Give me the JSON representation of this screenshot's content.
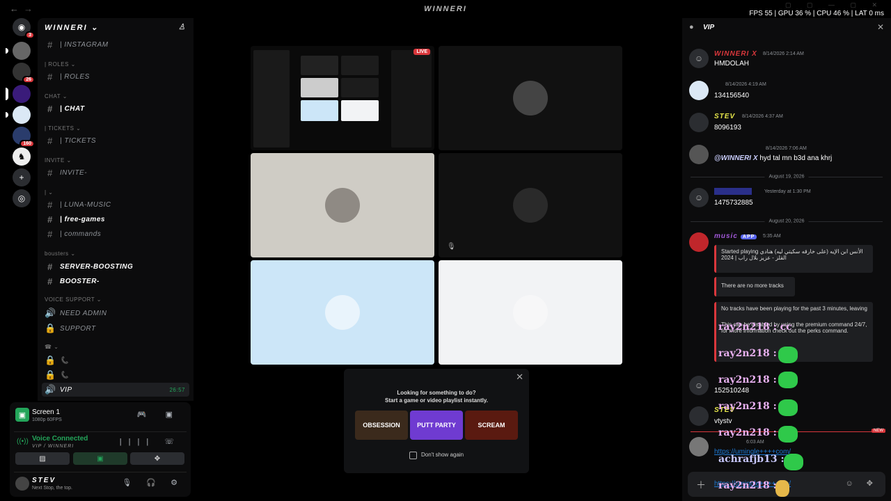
{
  "topbar": {
    "title": "WINNERI",
    "stats": "FPS  55  |  GPU 36 %  |  CPU 46 %  |  LAT 0 ms"
  },
  "rail": {
    "badges": [
      "3",
      "26",
      "160"
    ]
  },
  "server": {
    "name": "WINNERI"
  },
  "channels": [
    {
      "label": "| INSTAGRAM",
      "kind": "text"
    },
    {
      "label": "| ROLES",
      "kind": "category"
    },
    {
      "label": "| ROLES",
      "kind": "text"
    },
    {
      "label": "CHAT",
      "kind": "category"
    },
    {
      "label": "| CHAT",
      "kind": "text",
      "white": true
    },
    {
      "label": "| TICKETS",
      "kind": "category"
    },
    {
      "label": "| TICKETS",
      "kind": "text"
    },
    {
      "label": "INVITE",
      "kind": "category"
    },
    {
      "label": "INVITE-",
      "kind": "text"
    },
    {
      "label": "|",
      "kind": "category"
    },
    {
      "label": "| LUNA-MUSIC",
      "kind": "text"
    },
    {
      "label": "| free-games",
      "kind": "text",
      "white": true
    },
    {
      "label": "| commands",
      "kind": "text"
    },
    {
      "label": "bousters",
      "kind": "category"
    },
    {
      "label": "SERVER-BOOSTING",
      "kind": "text",
      "white": true
    },
    {
      "label": "BOOSTER-",
      "kind": "text",
      "white": true
    },
    {
      "label": "VOICE SUPPORT",
      "kind": "category"
    },
    {
      "label": "NEED ADMIN",
      "kind": "voice"
    },
    {
      "label": "SUPPORT",
      "kind": "voice"
    },
    {
      "label": "",
      "kind": "category"
    },
    {
      "label": "",
      "kind": "lock"
    },
    {
      "label": "",
      "kind": "lock"
    },
    {
      "label": "VIP",
      "kind": "active",
      "timer": "26:57"
    }
  ],
  "voice": {
    "screen_name": "Screen 1",
    "screen_sub": "1080p 60FPS",
    "connected": "Voice Connected",
    "channel_path": "VIP / WINNERI"
  },
  "user": {
    "name": "STEV",
    "status": "Next Stop, the top."
  },
  "popup": {
    "line1": "Looking for something to do?",
    "line2": "Start a game or video playlist instantly.",
    "games": [
      "OBSESSION",
      "PUTT PARTY",
      "SCREAM"
    ],
    "dont_show": "Don't show again"
  },
  "tiles": {
    "live": "LIVE"
  },
  "chat": {
    "channel": "VIP",
    "messages": [
      {
        "name": "WINNERI X",
        "color": "#da373c",
        "time": "8/14/2026 2:14 AM",
        "text": "HMDOLAH"
      },
      {
        "name": "",
        "color": "#ffffff",
        "time": "8/14/2026 4:19 AM",
        "text": "134156540"
      },
      {
        "name": "STEV",
        "color": "#e6e64a",
        "time": "8/14/2026 4:37 AM",
        "text": "8096193"
      },
      {
        "name": "",
        "color": "#ffffff",
        "time": "8/14/2026 7:06 AM",
        "text": "hyd tal mn b3d ana khrj",
        "mention": "@WINNERI X"
      },
      {
        "name": "",
        "color": "#5865f2",
        "time": "Yesterday at 1:30 PM",
        "text": "1475732885"
      },
      {
        "name": "music",
        "color": "#a259d9",
        "time": "5:35 AM",
        "text": ""
      }
    ],
    "dividers": [
      "August 19, 2026",
      "August 20, 2026"
    ],
    "embed1": "Started playing الأنس ابن الإيه (على خارقه سكيتي ليه) هنادي القلز - عزيز بلال راب | 2024",
    "embed2": "There are no more tracks",
    "embed3a": "No tracks have been playing for the past 3 minutes, leaving",
    "embed3b": "This can be disabled by using the premium command 24/7, for more information check out the perks command.",
    "app_badge": "APP",
    "later_text1": "152510248",
    "later_name": "STEV",
    "later_text2": "vtystv",
    "link_time": "6:03 AM",
    "link": "https://umingle++++com/",
    "input_link": "https://umingle++++com/",
    "new_label": "NEW"
  },
  "overlay": [
    {
      "text": "ray2n218 : cc",
      "color": "#e8b0f0"
    },
    {
      "text": "ray2n218 :",
      "color": "#e8b0f0"
    },
    {
      "text": "ray2n218 :",
      "color": "#e8b0f0"
    },
    {
      "text": "ray2n218 :",
      "color": "#e8b0f0"
    },
    {
      "text": "ray2n218 :",
      "color": "#e8b0f0"
    },
    {
      "text": "achrafjb13 :",
      "color": "#c8c8ff"
    },
    {
      "text": "ray2n218 :",
      "color": "#e8b0f0"
    }
  ]
}
